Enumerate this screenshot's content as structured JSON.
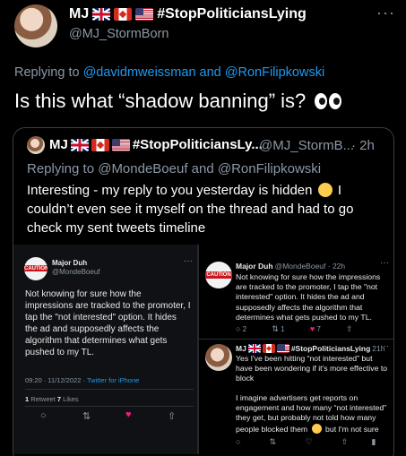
{
  "tweet": {
    "author_name": "MJ",
    "hashtag": "#StopPoliticiansLying",
    "handle": "@MJ_StormBorn",
    "more": "···",
    "replying_prefix": "Replying to",
    "replying_user1": "@davidmweissman",
    "replying_and": "and",
    "replying_user2": "@RonFilipkowski",
    "text": "Is  this what “shadow banning” is?"
  },
  "quote": {
    "author_name": "MJ",
    "hashtag": "#StopPoliticiansLy...",
    "handle": "@MJ_StormB...",
    "time": "· 2h",
    "replying": "Replying to @MondeBoeuf and @RonFilipkowski",
    "text_part1": "Interesting - my reply to you yesterday is hidden",
    "text_part2": " I couldn’t even see it myself on the thread and had to go check my sent tweets timeline"
  },
  "screenshot_left": {
    "name": "Major Duh",
    "handle": "@MondeBoeuf",
    "more": "···",
    "text": "Not knowing for sure how the impressions are tracked to the promoter, I tap the \"not interested\" option. It hides the ad and supposedly affects the algorithm that determines what gets pushed to my TL.",
    "timestamp": "09:20 · 11/12/2022 · ",
    "client": "Twitter for iPhone",
    "retweet_count": "1",
    "retweet_label": "Retweet",
    "like_count": "7",
    "like_label": "Likes"
  },
  "screenshot_right": {
    "post1": {
      "name": "Major Duh",
      "handle_time": "@MondeBoeuf · 22h",
      "more": "···",
      "text": "Not knowing for sure how the impressions are tracked to the promoter, I tap the \"not interested\" option. It hides the ad and supposedly affects the algorithm that determines what gets pushed to my TL.",
      "reply_count": "2",
      "retweet_count": "1",
      "like_count": "7"
    },
    "post2": {
      "name": "MJ",
      "hashtag": "#StopPoliticiansLying",
      "time": "21h",
      "more": "···",
      "text1": "Yes I've been hitting “not interested” but have been wondering if it's more effective to block",
      "text2": "I imagine advertisers get reports on engagement and how many “not interested” they get, but probably not told how many people blocked them",
      "text3": " but I'm not sure"
    }
  }
}
